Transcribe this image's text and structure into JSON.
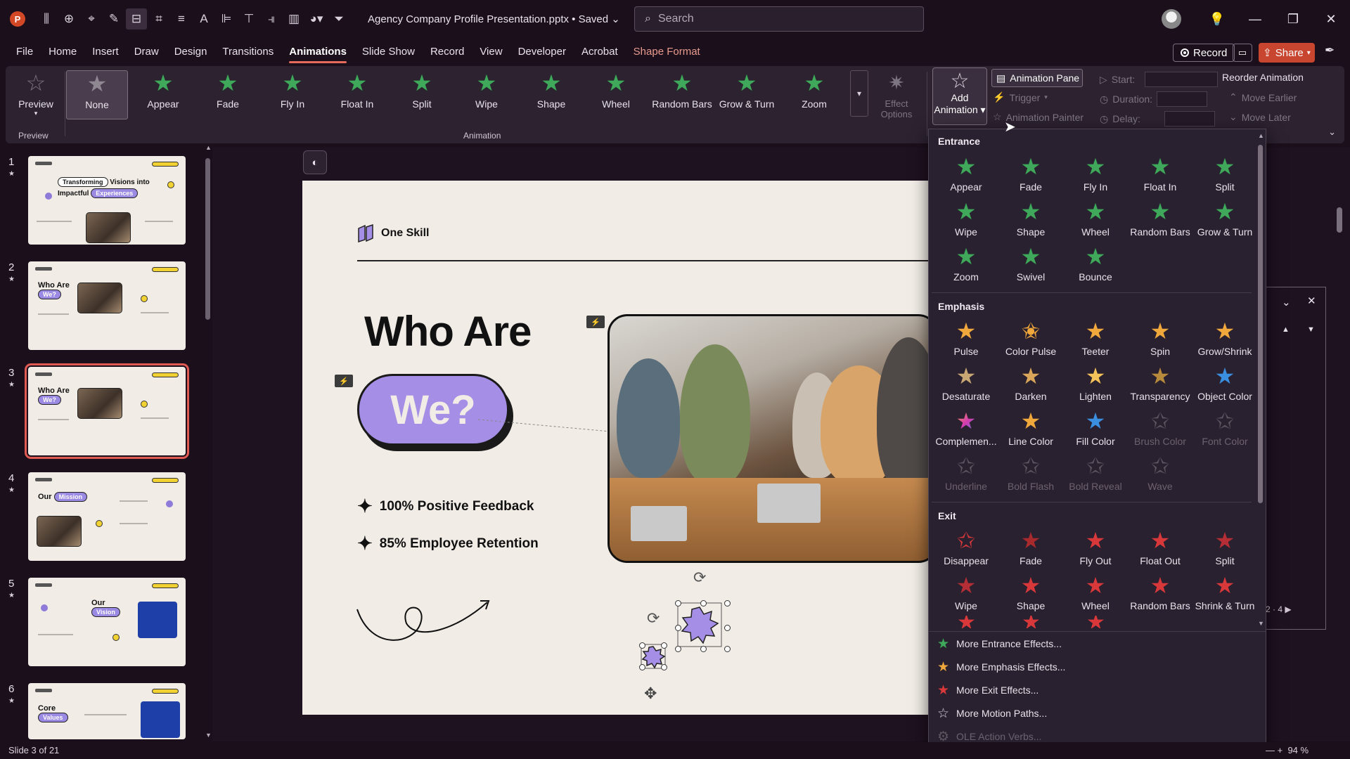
{
  "titlebar": {
    "app_logo": "P",
    "doc_title": "Agency Company Profile Presentation.pptx • Saved",
    "search_placeholder": "Search"
  },
  "menu": {
    "items": [
      "File",
      "Home",
      "Insert",
      "Draw",
      "Design",
      "Transitions",
      "Animations",
      "Slide Show",
      "Record",
      "View",
      "Developer",
      "Acrobat",
      "Shape Format"
    ],
    "active": "Animations",
    "record_label": "Record",
    "share_label": "Share"
  },
  "ribbon": {
    "preview_label": "Preview",
    "preview_group": "Preview",
    "animation_group": "Animation",
    "gallery": [
      "None",
      "Appear",
      "Fade",
      "Fly In",
      "Float In",
      "Split",
      "Wipe",
      "Shape",
      "Wheel",
      "Random Bars",
      "Grow & Turn",
      "Zoom"
    ],
    "effect_options": "Effect Options",
    "add_animation_l1": "Add",
    "add_animation_l2": "Animation",
    "animation_pane": "Animation Pane",
    "trigger": "Trigger",
    "animation_painter": "Animation Painter",
    "start": "Start:",
    "duration": "Duration:",
    "delay": "Delay:",
    "reorder": "Reorder Animation",
    "move_earlier": "Move Earlier",
    "move_later": "Move Later"
  },
  "thumbnails": {
    "numbers": [
      "1",
      "2",
      "3",
      "4",
      "5",
      "6"
    ],
    "t1_a": "Transforming",
    "t1_b": "Visions into",
    "t1_c": "Impactful",
    "t1_d": "Experiences",
    "t2_a": "Who Are",
    "t2_b": "We?",
    "t3_a": "Who Are",
    "t3_b": "We?",
    "t4_a": "Our",
    "t4_b": "Mission",
    "t5_a": "Our",
    "t5_b": "Vision",
    "t6_a": "Core",
    "t6_b": "Values"
  },
  "slide": {
    "brand": "One Skill",
    "title": "Who Are",
    "pill": "We?",
    "bullet1": "100% Positive Feedback",
    "bullet2": "85% Employee Retention"
  },
  "dropdown": {
    "entrance_title": "Entrance",
    "entrance": [
      "Appear",
      "Fade",
      "Fly In",
      "Float In",
      "Split",
      "Wipe",
      "Shape",
      "Wheel",
      "Random Bars",
      "Grow & Turn",
      "Zoom",
      "Swivel",
      "Bounce"
    ],
    "emphasis_title": "Emphasis",
    "emphasis": [
      "Pulse",
      "Color Pulse",
      "Teeter",
      "Spin",
      "Grow/Shrink",
      "Desaturate",
      "Darken",
      "Lighten",
      "Transparency",
      "Object Color",
      "Complemen...",
      "Line Color",
      "Fill Color",
      "Brush Color",
      "Font Color",
      "Underline",
      "Bold Flash",
      "Bold Reveal",
      "Wave"
    ],
    "exit_title": "Exit",
    "exit": [
      "Disappear",
      "Fade",
      "Fly Out",
      "Float Out",
      "Split",
      "Wipe",
      "Shape",
      "Wheel",
      "Random Bars",
      "Shrink & Turn"
    ],
    "more_entrance": "More Entrance Effects...",
    "more_emphasis": "More Emphasis Effects...",
    "more_exit": "More Exit Effects...",
    "more_motion": "More Motion Paths...",
    "ole": "OLE Action Verbs..."
  },
  "pane": {
    "pages": "2 · 4"
  },
  "status": {
    "slide_info": "Slide 3 of 21",
    "zoom": "94 %"
  }
}
